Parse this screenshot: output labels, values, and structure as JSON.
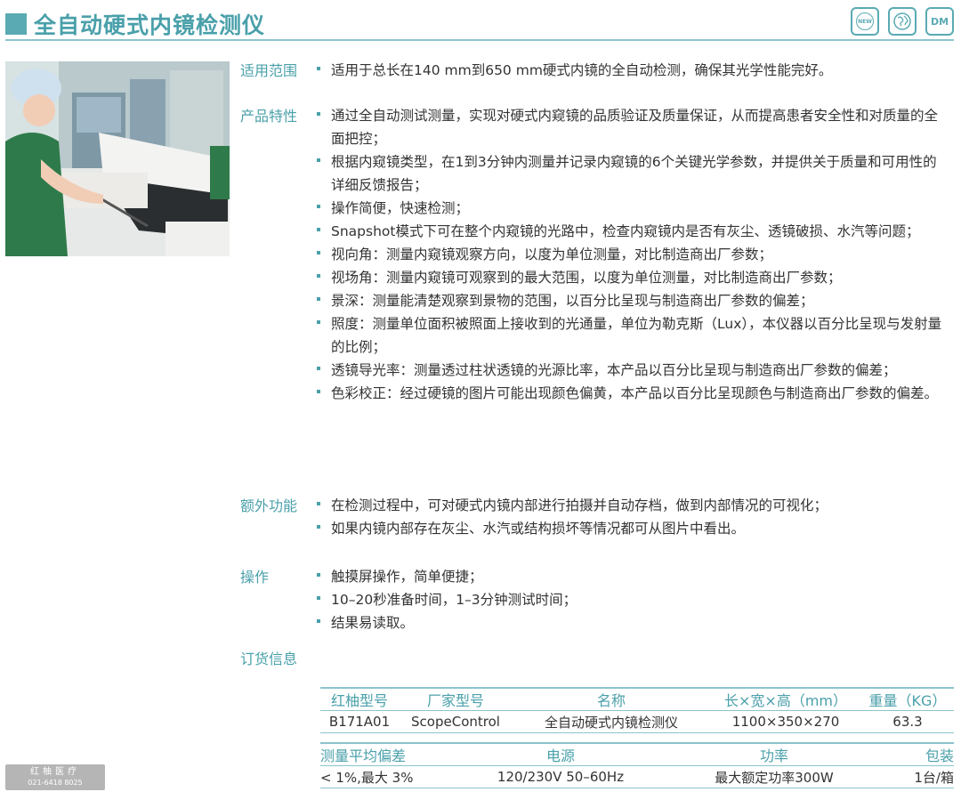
{
  "header": {
    "title": "全自动硬式内镜检测仪",
    "badges": [
      {
        "icon": "new-badge-icon",
        "text": "NEW"
      },
      {
        "icon": "globe-badge-icon",
        "text": ""
      },
      {
        "icon": "dm-badge-icon",
        "text": "DM"
      }
    ]
  },
  "sections": {
    "scope": {
      "label": "适用范围",
      "items": [
        "适用于总长在140 mm到650 mm硬式内镜的全自动检测，确保其光学性能完好。"
      ]
    },
    "features": {
      "label": "产品特性",
      "items": [
        "通过全自动测试测量，实现对硬式内窥镜的品质验证及质量保证，从而提高患者安全性和对质量的全面把控；",
        "根据内窥镜类型，在1到3分钟内测量并记录内窥镜的6个关键光学参数，并提供关于质量和可用性的详细反馈报告；",
        "操作简便，快速检测；",
        "Snapshot模式下可在整个内窥镜的光路中，检查内窥镜内是否有灰尘、透镜破损、水汽等问题；",
        "视向角：测量内窥镜观察方向，以度为单位测量，对比制造商出厂参数；",
        "视场角：测量内窥镜可观察到的最大范围，以度为单位测量，对比制造商出厂参数；",
        "景深：测量能清楚观察到景物的范围，以百分比呈现与制造商出厂参数的偏差；",
        "照度：测量单位面积被照面上接收到的光通量，单位为勒克斯（Lux），本仪器以百分比呈现与发射量的比例；",
        "透镜导光率：测量透过柱状透镜的光源比率，本产品以百分比呈现与制造商出厂参数的偏差；",
        "色彩校正：经过硬镜的图片可能出现颜色偏黄，本产品以百分比呈现颜色与制造商出厂参数的偏差。"
      ]
    },
    "extra": {
      "label": "额外功能",
      "items": [
        "在检测过程中，可对硬式内镜内部进行拍摄并自动存档，做到内部情况的可视化；",
        "如果内镜内部存在灰尘、水汽或结构损坏等情况都可从图片中看出。"
      ]
    },
    "operation": {
      "label": "操作",
      "items": [
        "触摸屏操作，简单便捷；",
        "10–20秒准备时间，1–3分钟测试时间；",
        "结果易读取。"
      ]
    },
    "order": {
      "label": "订货信息"
    }
  },
  "table1": {
    "headers": [
      "红柚型号",
      "厂家型号",
      "名称",
      "长×宽×高（mm）",
      "重量（KG）"
    ],
    "row": [
      "B171A01",
      "ScopeControl",
      "全自动硬式内镜检测仪",
      "1100×350×270",
      "63.3"
    ]
  },
  "table2": {
    "headers": [
      "测量平均偏差",
      "电源",
      "功率",
      "包装"
    ],
    "row": [
      "< 1%,最大 3%",
      "120/230V 50–60Hz",
      "最大额定功率300W",
      "1台/箱"
    ]
  },
  "watermark": {
    "line1": "红柚医疗",
    "line2": "021-6418 8025"
  }
}
